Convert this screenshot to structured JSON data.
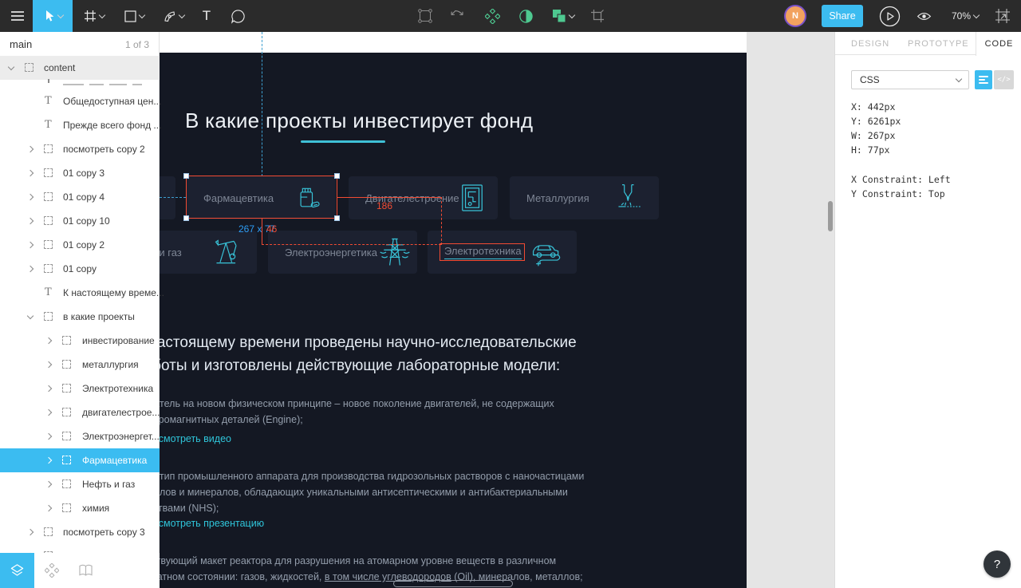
{
  "toolbar": {
    "share_label": "Share",
    "zoom_level": "70%",
    "avatar_initial": "N"
  },
  "left_panel": {
    "page_name": "main",
    "page_indicator": "1 of 3",
    "rows": [
      {
        "label": "content"
      },
      {
        "label": "Общедоступная цен..."
      },
      {
        "label": "Прежде всего фонд ..."
      },
      {
        "label": "посмотреть copy 2"
      },
      {
        "label": "01 copy 3"
      },
      {
        "label": "01 copy 4"
      },
      {
        "label": "01 copy 10"
      },
      {
        "label": "01 copy 2"
      },
      {
        "label": "01 copy"
      },
      {
        "label": "К настоящему време..."
      },
      {
        "label": "в какие проекты"
      },
      {
        "label": "инвестирование"
      },
      {
        "label": "металлургия"
      },
      {
        "label": "Электротехника"
      },
      {
        "label": "двигателестрое..."
      },
      {
        "label": "Электроэнергет..."
      },
      {
        "label": "Фармацевтика"
      },
      {
        "label": "Нефть и газ"
      },
      {
        "label": "химия"
      },
      {
        "label": "посмотреть copy 3"
      }
    ]
  },
  "right_panel": {
    "tabs": {
      "design": "DESIGN",
      "prototype": "PROTOTYPE",
      "code": "CODE"
    },
    "language_select": "CSS",
    "code_lines": [
      "X: 442px",
      "Y: 6261px",
      "W: 267px",
      "H: 77px"
    ],
    "constraint_lines": [
      "X Constraint: Left",
      "Y Constraint: Top"
    ],
    "help_label": "?"
  },
  "canvas": {
    "heading": "В какие проекты инвестирует фонд",
    "cards_row1": [
      "Фармацевтика",
      "Двигателестроение",
      "Металлургия"
    ],
    "cards_row2": [
      "Нефть и газ",
      "Электроэнергетика",
      "Электротехника"
    ],
    "measurements": {
      "size_label": "267 x 77",
      "h_distance": "186",
      "v_distance": "46"
    },
    "section_heading": "К настоящему времени проведены научно-исследовательские\nработы и изготовлены действующие лабораторные модели:",
    "paragraph1": "Двигатель на новом физическом принципе – новое поколение двигателей, не содержащих\nэлектромагнитных деталей (Engine);",
    "link1": "посмотреть видео",
    "paragraph2": "Прототип промышленного аппарата для производства гидрозольных растворов с наночастицами\nметаллов и минералов, обладающих уникальными антисептическими и антибактериальными\nсвойствами (NHS);",
    "link2": "посмотреть презентацию",
    "paragraph3_line1": "Действующий макет реактора для разрушения на атомарном уровне веществ в различном",
    "paragraph3_before": "агрегатном состоянии: газов, жидкостей, ",
    "paragraph3_underlined": "в том числе углеводородов",
    "paragraph3_after": " (Oil), минералов, металлов;"
  }
}
